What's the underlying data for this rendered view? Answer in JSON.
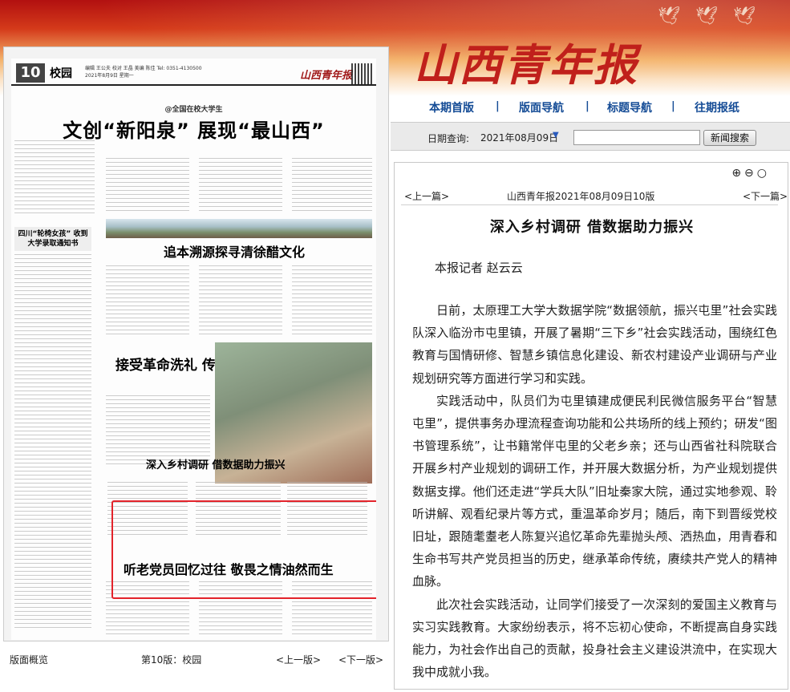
{
  "masthead": "山西青年报",
  "nav": {
    "items": [
      "本期首版",
      "版面导航",
      "标题导航",
      "往期报纸"
    ]
  },
  "date_query": {
    "label": "日期查询:",
    "selected_date": "2021年08月09日",
    "search_placeholder": "",
    "search_button": "新闻搜索"
  },
  "paper": {
    "page_num": "10",
    "section": "校园",
    "meta": "编辑 王公夫 校对 王晶 美编 陈佳 Tel: 0351-4130500 2021年8月9日 星期一",
    "logo": "山西青年报",
    "kicker": "@全国在校大学生",
    "headline": "文创“新阳泉” 展现“最山西”",
    "side_box": "四川“轮椅女孩” 收到大学录取通知书",
    "headline2": "追本溯源探寻清徐醋文化",
    "headline3": "接受革命洗礼 传承红色精神",
    "headline4": "深入乡村调研 借数据助力振兴",
    "headline5": "听老党员回忆过往 敬畏之情油然而生"
  },
  "paper_footer": {
    "overview": "版面概览",
    "page_label": "第10版：校园",
    "prev": "<上一版>",
    "next": "<下一版>"
  },
  "article": {
    "zoom_icons": [
      "zoom-in-icon",
      "zoom-out-icon",
      "reset-icon"
    ],
    "prev": "<上一篇>",
    "location": "山西青年报2021年08月09日10版",
    "next": "<下一篇>",
    "title": "深入乡村调研 借数据助力振兴",
    "byline": "本报记者 赵云云",
    "paragraphs": [
      "日前，太原理工大学大数据学院“数据领航，振兴屯里”社会实践队深入临汾市屯里镇，开展了暑期“三下乡”社会实践活动，围绕红色教育与国情研修、智慧乡镇信息化建设、新农村建设产业调研与产业规划研究等方面进行学习和实践。",
      "实践活动中，队员们为屯里镇建成便民利民微信服务平台“智慧屯里”，提供事务办理流程查询功能和公共场所的线上预约；研发“图书管理系统”，让书籍常伴屯里的父老乡亲；还与山西省社科院联合开展乡村产业规划的调研工作，并开展大数据分析，为产业规划提供数据支撑。他们还走进“学兵大队”旧址秦家大院，通过实地参观、聆听讲解、观看纪录片等方式，重温革命岁月；随后，南下到晋绥党校旧址，跟随耄耋老人陈复兴追忆革命先辈抛头颅、洒热血，用青春和生命书写共产党员担当的历史，继承革命传统，赓续共产党人的精神血脉。",
      "此次社会实践活动，让同学们接受了一次深刻的爱国主义教育与实习实践教育。大家纷纷表示，将不忘初心使命，不断提高自身实践能力，为社会作出自己的贡献，投身社会主义建设洪流中，在实现大我中成就小我。"
    ]
  }
}
